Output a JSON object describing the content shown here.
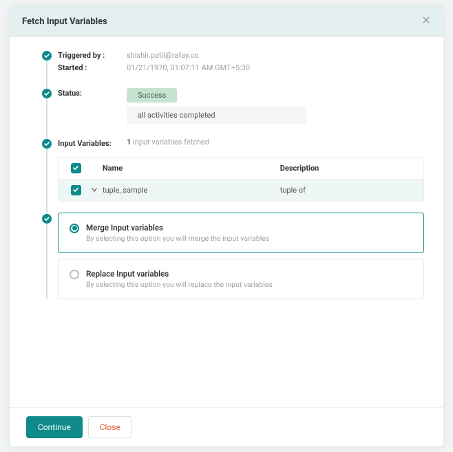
{
  "header": {
    "title": "Fetch Input Variables"
  },
  "triggered": {
    "triggered_label": "Triggered by :",
    "triggered_value": "shishir.patil@rafay.co",
    "started_label": "Started :",
    "started_value": "01/21/1970, 01:07:11 AM GMT+5:30"
  },
  "status": {
    "label": "Status:",
    "badge": "Success",
    "message": "all activities completed"
  },
  "inputs": {
    "label": "Input Variables:",
    "count": "1",
    "fetched_suffix": "input variables fetched",
    "columns": {
      "name": "Name",
      "desc": "Description"
    },
    "rows": [
      {
        "name": "tuple_sample",
        "desc": "tuple of"
      }
    ]
  },
  "options": {
    "merge": {
      "title": "Merge Input variables",
      "desc": "By selecting this option you will merge the input variables"
    },
    "replace": {
      "title": "Replace Input variables",
      "desc": "By selecting this option you will replace the input variables"
    }
  },
  "footer": {
    "continue": "Continue",
    "close": "Close"
  }
}
